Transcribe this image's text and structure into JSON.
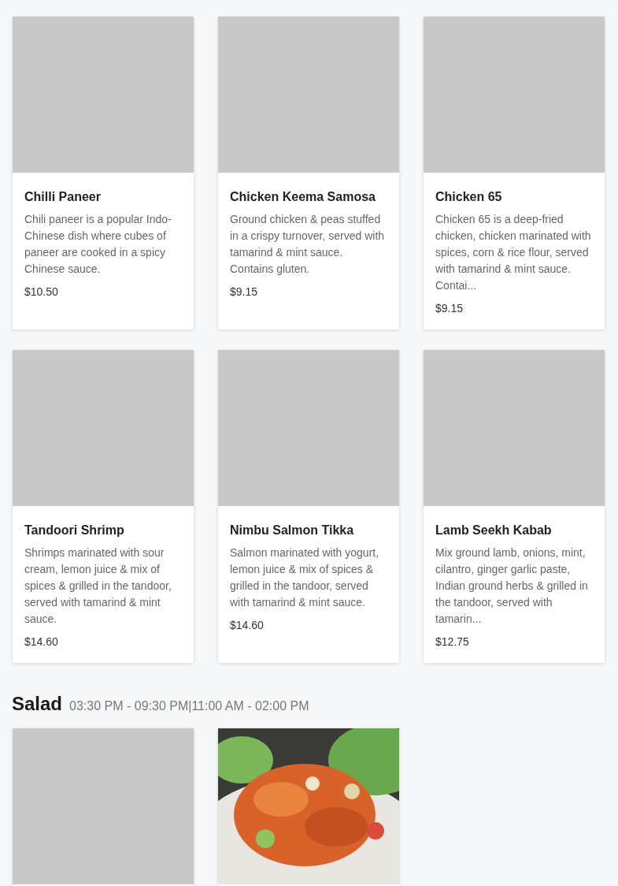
{
  "sections": [
    {
      "items": [
        {
          "name": "Chilli Paneer",
          "description": "Chili paneer is a popular Indo-Chinese dish where cubes of paneer are cooked in a spicy Chinese sauce.",
          "price": "$10.50",
          "image": {
            "kind": "placeholder"
          }
        },
        {
          "name": "Chicken Keema Samosa",
          "description": "Ground chicken & peas stuffed in a crispy turnover, served with tamarind & mint sauce. Contains gluten.",
          "price": "$9.15",
          "image": {
            "kind": "placeholder"
          }
        },
        {
          "name": "Chicken 65",
          "description": "Chicken 65 is a deep-fried chicken, chicken marinated with spices, corn & rice flour, served with tamarind & mint sauce. Contai...",
          "price": "$9.15",
          "image": {
            "kind": "placeholder"
          }
        },
        {
          "name": "Tandoori Shrimp",
          "description": "Shrimps marinated with sour cream, lemon juice & mix of spices & grilled in the tandoor, served with tamarind & mint sauce.",
          "price": "$14.60",
          "image": {
            "kind": "placeholder"
          }
        },
        {
          "name": "Nimbu Salmon Tikka",
          "description": "Salmon marinated with yogurt, lemon juice & mix of spices & grilled in the tandoor, served with tamarind & mint sauce.",
          "price": "$14.60",
          "image": {
            "kind": "placeholder"
          }
        },
        {
          "name": "Lamb Seekh Kabab",
          "description": "Mix ground lamb, onions, mint, cilantro, ginger garlic paste, Indian ground herbs & grilled in the tandoor, served with tamarin...",
          "price": "$12.75",
          "image": {
            "kind": "placeholder"
          }
        }
      ]
    },
    {
      "title": "Salad",
      "hours": "03:30 PM - 09:30 PM|11:00 AM - 02:00 PM",
      "items": [
        {
          "image": {
            "kind": "placeholder"
          }
        },
        {
          "image": {
            "kind": "picture"
          }
        }
      ]
    }
  ]
}
